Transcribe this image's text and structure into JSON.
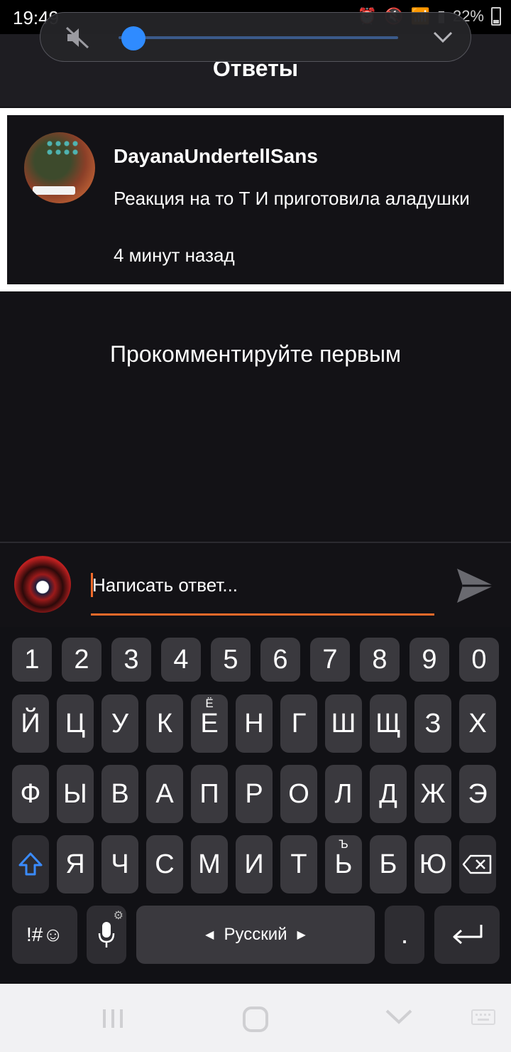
{
  "status_bar": {
    "time": "19:49",
    "battery": "22%"
  },
  "volume_panel": {
    "level": 0.05
  },
  "header": {
    "title": "Ответы"
  },
  "comment": {
    "author": "DayanaUndertellSans",
    "text": "Реакция на то Т И приготовила аладушки",
    "time": "4 минут назад"
  },
  "empty_state": "Прокомментируйте первым",
  "reply": {
    "placeholder": "Написать ответ..."
  },
  "keyboard": {
    "numbers": [
      "1",
      "2",
      "3",
      "4",
      "5",
      "6",
      "7",
      "8",
      "9",
      "0"
    ],
    "row1": [
      "Й",
      "Ц",
      "У",
      "К",
      "Е",
      "Н",
      "Г",
      "Ш",
      "Щ",
      "З",
      "Х"
    ],
    "row1_hint": "Ё",
    "row2": [
      "Ф",
      "Ы",
      "В",
      "А",
      "П",
      "Р",
      "О",
      "Л",
      "Д",
      "Ж",
      "Э"
    ],
    "row3": [
      "Я",
      "Ч",
      "С",
      "М",
      "И",
      "Т",
      "Ь",
      "Б",
      "Ю"
    ],
    "row3_hint": "Ъ",
    "symbols": "!#☺",
    "language": "Русский",
    "period": "."
  },
  "colors": {
    "accent": "#f06a2a",
    "volume_knob": "#2f8bff",
    "background": "#131216"
  }
}
